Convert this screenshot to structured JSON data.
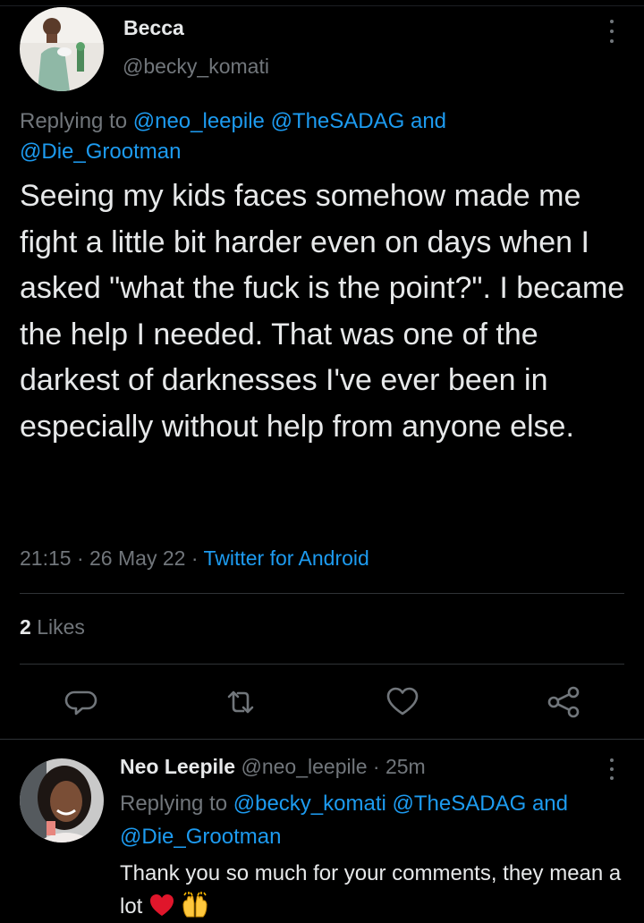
{
  "tweet": {
    "author_name": "Becca",
    "author_handle": "@becky_komati",
    "replying_prefix": "Replying to",
    "replying_to_1": "@neo_leepile",
    "replying_to_2": "@TheSADAG",
    "replying_and": "and",
    "replying_to_3": "@Die_Grootman",
    "text": "Seeing my kids faces somehow made me fight a little bit harder even on days when I asked \"what the fuck is the point?\". I became the help I needed. That was one of the darkest of darknesses I've ever been in especially without help from anyone else.",
    "time": "21:15",
    "dot": "·",
    "date": "26 May 22",
    "source": "Twitter for Android",
    "likes_count": "2",
    "likes_label": "Likes"
  },
  "actions": {
    "reply_icon": "reply-icon",
    "retweet_icon": "retweet-icon",
    "like_icon": "heart-icon",
    "share_icon": "share-icon"
  },
  "reply": {
    "author_name": "Neo Leepile",
    "author_handle": "@neo_leepile",
    "dot": "·",
    "time": "25m",
    "replying_prefix": "Replying to",
    "replying_to_1": "@becky_komati",
    "replying_to_2": "@TheSADAG",
    "replying_and": "and",
    "replying_to_3": "@Die_Grootman",
    "text": "Thank you so much for your comments, they mean a lot",
    "emojis": [
      "red-heart-emoji",
      "raising-hands-emoji"
    ]
  },
  "colors": {
    "background": "#000000",
    "text": "#e7e9ea",
    "secondary": "#71767b",
    "link": "#1d9bf0",
    "divider": "#2f3336"
  }
}
